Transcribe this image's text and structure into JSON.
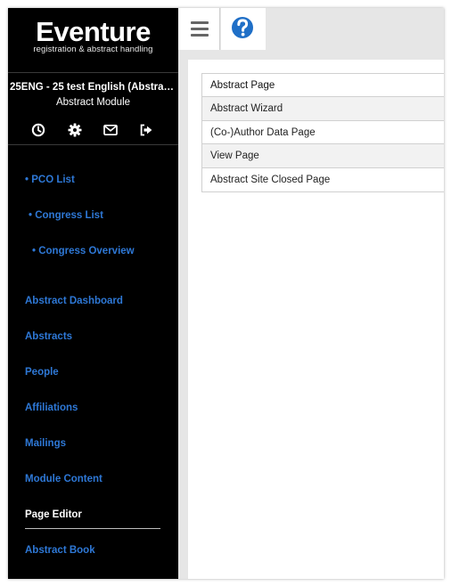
{
  "app": {
    "logo_title": "Eventure",
    "logo_subtitle": "registration & abstract handling"
  },
  "sidebar": {
    "congress_name": "25ENG - 25 test English (Abstracts...",
    "module_name": "Abstract Module",
    "icons": [
      "history-icon",
      "gear-icon",
      "envelope-icon",
      "logout-icon"
    ],
    "top_links": [
      {
        "label": "• PCO List"
      },
      {
        "label": "• Congress List"
      },
      {
        "label": "• Congress Overview"
      }
    ],
    "menu": [
      {
        "label": "Abstract Dashboard",
        "active": false
      },
      {
        "label": "Abstracts",
        "active": false
      },
      {
        "label": "People",
        "active": false
      },
      {
        "label": "Affiliations",
        "active": false
      },
      {
        "label": "Mailings",
        "active": false
      },
      {
        "label": "Module Content",
        "active": false
      },
      {
        "label": "Page Editor",
        "active": true
      },
      {
        "label": "Abstract Book",
        "active": false
      }
    ]
  },
  "topbar": {
    "menu_icon": "hamburger-icon",
    "help_icon": "help-icon"
  },
  "pages": {
    "header": "Abstract Page",
    "items": [
      "Abstract Wizard",
      "(Co-)Author Data Page",
      "View Page",
      "Abstract Site Closed Page"
    ]
  },
  "colors": {
    "sidebar_bg": "#000000",
    "link_blue": "#2e78d6",
    "help_blue": "#1f6fc7",
    "content_bg": "#e6e6e6"
  }
}
